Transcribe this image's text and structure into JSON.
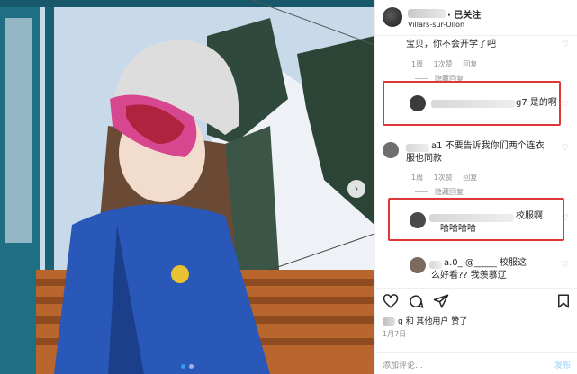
{
  "header": {
    "follow_state": "· 已关注",
    "location": "Villars-sur-Ollon"
  },
  "comments": [
    {
      "text": "宝贝，你不会开学了吧",
      "meta": {
        "time": "1周",
        "likes": "1次赞",
        "reply": "回复"
      },
      "replies_toggle": "隐藏回复"
    },
    {
      "visible_suffix": "g7 是的啊",
      "highlighted": true
    },
    {
      "text_line1": "a1 不要告诉我你们两个连衣",
      "text_line2": "服也同款",
      "meta": {
        "time": "1周",
        "likes": "1次赞",
        "reply": "回复"
      },
      "replies_toggle": "隐藏回复"
    },
    {
      "text_line1": "校服啊",
      "text_line2": "哈哈哈哈",
      "highlighted": true
    },
    {
      "text_line1": "a.0_ @_____ 校服这",
      "text_line2": "么好看?? 我羡慕辽"
    }
  ],
  "footer": {
    "liked_by_visible": "g 和 其他用户 赞了",
    "date": "1月7日",
    "add_comment_placeholder": "添加评论...",
    "post_label": "发布"
  },
  "icons": {
    "heart": "heart-icon",
    "comment": "comment-icon",
    "share": "share-icon",
    "bookmark": "bookmark-icon",
    "carousel_next": "chevron-right-icon"
  },
  "colors": {
    "highlight_box": "#e0373b",
    "accent_blue": "#3897f0",
    "meta_grey": "#8e8e8e"
  },
  "carousel": {
    "total": 2,
    "active": 1
  }
}
